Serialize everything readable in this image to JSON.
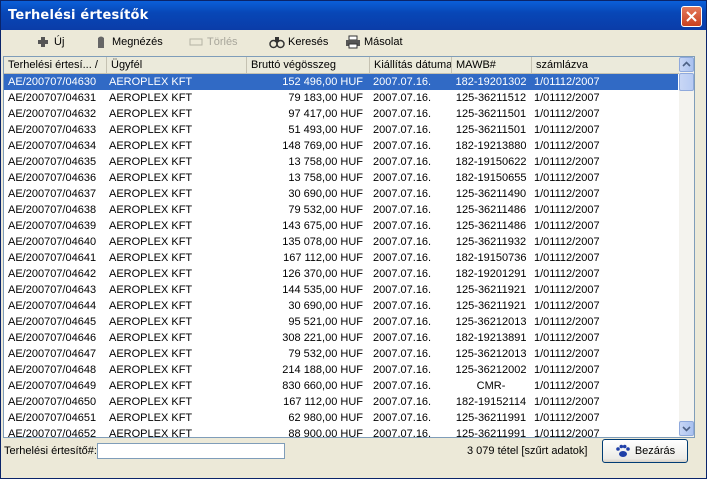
{
  "window": {
    "title": "Terhelési értesítők"
  },
  "toolbar": {
    "new_label": "Új",
    "view_label": "Megnézés",
    "delete_label": "Törlés",
    "search_label": "Keresés",
    "copy_label": "Másolat"
  },
  "table": {
    "columns": [
      "Terhelési értesí... /",
      "Ügyfél",
      "Bruttó végösszeg",
      "Kiállítás dátuma",
      "MAWB#",
      "számlázva"
    ],
    "rows": [
      [
        "AE/200707/04630",
        "AEROPLEX KFT",
        "152 496,00 HUF",
        "2007.07.16.",
        "182-19201302",
        "1/01112/2007"
      ],
      [
        "AE/200707/04631",
        "AEROPLEX KFT",
        "79 183,00 HUF",
        "2007.07.16.",
        "125-36211512",
        "1/01112/2007"
      ],
      [
        "AE/200707/04632",
        "AEROPLEX KFT",
        "97 417,00 HUF",
        "2007.07.16.",
        "125-36211501",
        "1/01112/2007"
      ],
      [
        "AE/200707/04633",
        "AEROPLEX KFT",
        "51 493,00 HUF",
        "2007.07.16.",
        "125-36211501",
        "1/01112/2007"
      ],
      [
        "AE/200707/04634",
        "AEROPLEX KFT",
        "148 769,00 HUF",
        "2007.07.16.",
        "182-19213880",
        "1/01112/2007"
      ],
      [
        "AE/200707/04635",
        "AEROPLEX KFT",
        "13 758,00 HUF",
        "2007.07.16.",
        "182-19150622",
        "1/01112/2007"
      ],
      [
        "AE/200707/04636",
        "AEROPLEX KFT",
        "13 758,00 HUF",
        "2007.07.16.",
        "182-19150655",
        "1/01112/2007"
      ],
      [
        "AE/200707/04637",
        "AEROPLEX KFT",
        "30 690,00 HUF",
        "2007.07.16.",
        "125-36211490",
        "1/01112/2007"
      ],
      [
        "AE/200707/04638",
        "AEROPLEX KFT",
        "79 532,00 HUF",
        "2007.07.16.",
        "125-36211486",
        "1/01112/2007"
      ],
      [
        "AE/200707/04639",
        "AEROPLEX KFT",
        "143 675,00 HUF",
        "2007.07.16.",
        "125-36211486",
        "1/01112/2007"
      ],
      [
        "AE/200707/04640",
        "AEROPLEX KFT",
        "135 078,00 HUF",
        "2007.07.16.",
        "125-36211932",
        "1/01112/2007"
      ],
      [
        "AE/200707/04641",
        "AEROPLEX KFT",
        "167 112,00 HUF",
        "2007.07.16.",
        "182-19150736",
        "1/01112/2007"
      ],
      [
        "AE/200707/04642",
        "AEROPLEX KFT",
        "126 370,00 HUF",
        "2007.07.16.",
        "182-19201291",
        "1/01112/2007"
      ],
      [
        "AE/200707/04643",
        "AEROPLEX KFT",
        "144 535,00 HUF",
        "2007.07.16.",
        "125-36211921",
        "1/01112/2007"
      ],
      [
        "AE/200707/04644",
        "AEROPLEX KFT",
        "30 690,00 HUF",
        "2007.07.16.",
        "125-36211921",
        "1/01112/2007"
      ],
      [
        "AE/200707/04645",
        "AEROPLEX KFT",
        "95 521,00 HUF",
        "2007.07.16.",
        "125-36212013",
        "1/01112/2007"
      ],
      [
        "AE/200707/04646",
        "AEROPLEX KFT",
        "308 221,00 HUF",
        "2007.07.16.",
        "182-19213891",
        "1/01112/2007"
      ],
      [
        "AE/200707/04647",
        "AEROPLEX KFT",
        "79 532,00 HUF",
        "2007.07.16.",
        "125-36212013",
        "1/01112/2007"
      ],
      [
        "AE/200707/04648",
        "AEROPLEX KFT",
        "214 188,00 HUF",
        "2007.07.16.",
        "125-36212002",
        "1/01112/2007"
      ],
      [
        "AE/200707/04649",
        "AEROPLEX KFT",
        "830 660,00 HUF",
        "2007.07.16.",
        "CMR-",
        "1/01112/2007"
      ],
      [
        "AE/200707/04650",
        "AEROPLEX KFT",
        "167 112,00 HUF",
        "2007.07.16.",
        "182-19152114",
        "1/01112/2007"
      ],
      [
        "AE/200707/04651",
        "AEROPLEX KFT",
        "62 980,00 HUF",
        "2007.07.16.",
        "125-36211991",
        "1/01112/2007"
      ],
      [
        "AE/200707/04652",
        "AEROPLEX KFT",
        "88 900,00 HUF",
        "2007.07.16.",
        "125-36211991",
        "1/01112/2007"
      ]
    ],
    "selected_row": 0
  },
  "status": {
    "search_label": "Terhelési értesítő#:",
    "search_value": "",
    "count_text": "3 079 tétel  [szűrt adatok]",
    "close_label": "Bezárás"
  },
  "colors": {
    "title_bar": "#0847b7",
    "selection": "#316ac5",
    "close_button": "#c8401f"
  }
}
